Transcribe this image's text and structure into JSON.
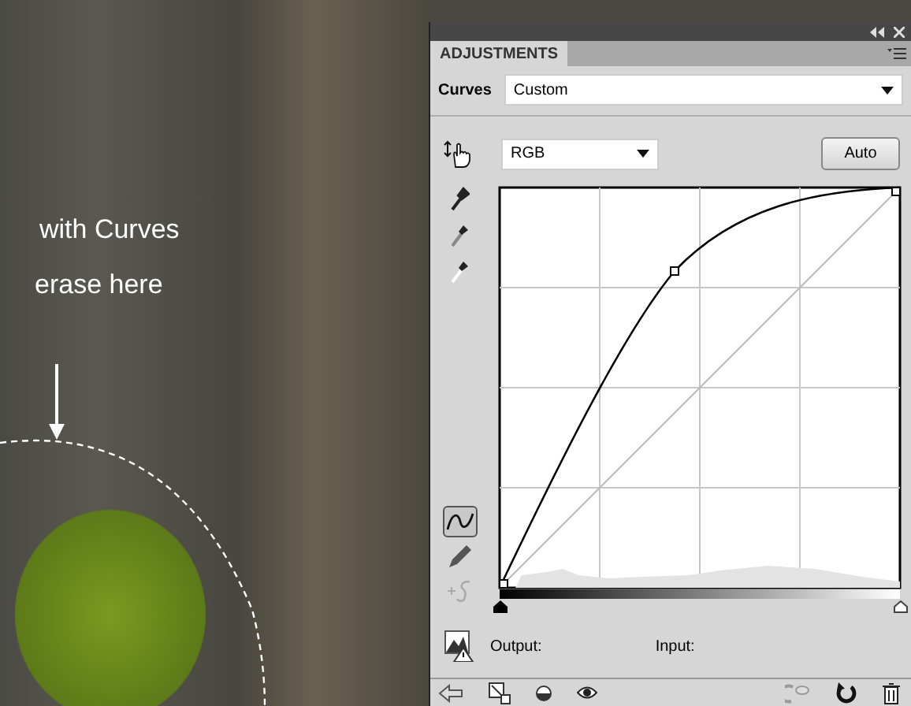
{
  "photo": {
    "annotations": [
      {
        "text": "with Curves"
      },
      {
        "text": "erase here"
      }
    ]
  },
  "panel": {
    "tab": "ADJUSTMENTS",
    "preset_label": "Curves",
    "preset_value": "Custom",
    "channel": "RGB",
    "auto_button": "Auto",
    "tools": [
      {
        "kind": "curve",
        "selected": true
      },
      {
        "kind": "pencil",
        "selected": false
      },
      {
        "kind": "smooth",
        "selected": false
      }
    ],
    "black_point": {
      "level": 0
    },
    "white_point": {
      "level": 1
    },
    "output_label": "Output:",
    "input_label": "Input:"
  }
}
